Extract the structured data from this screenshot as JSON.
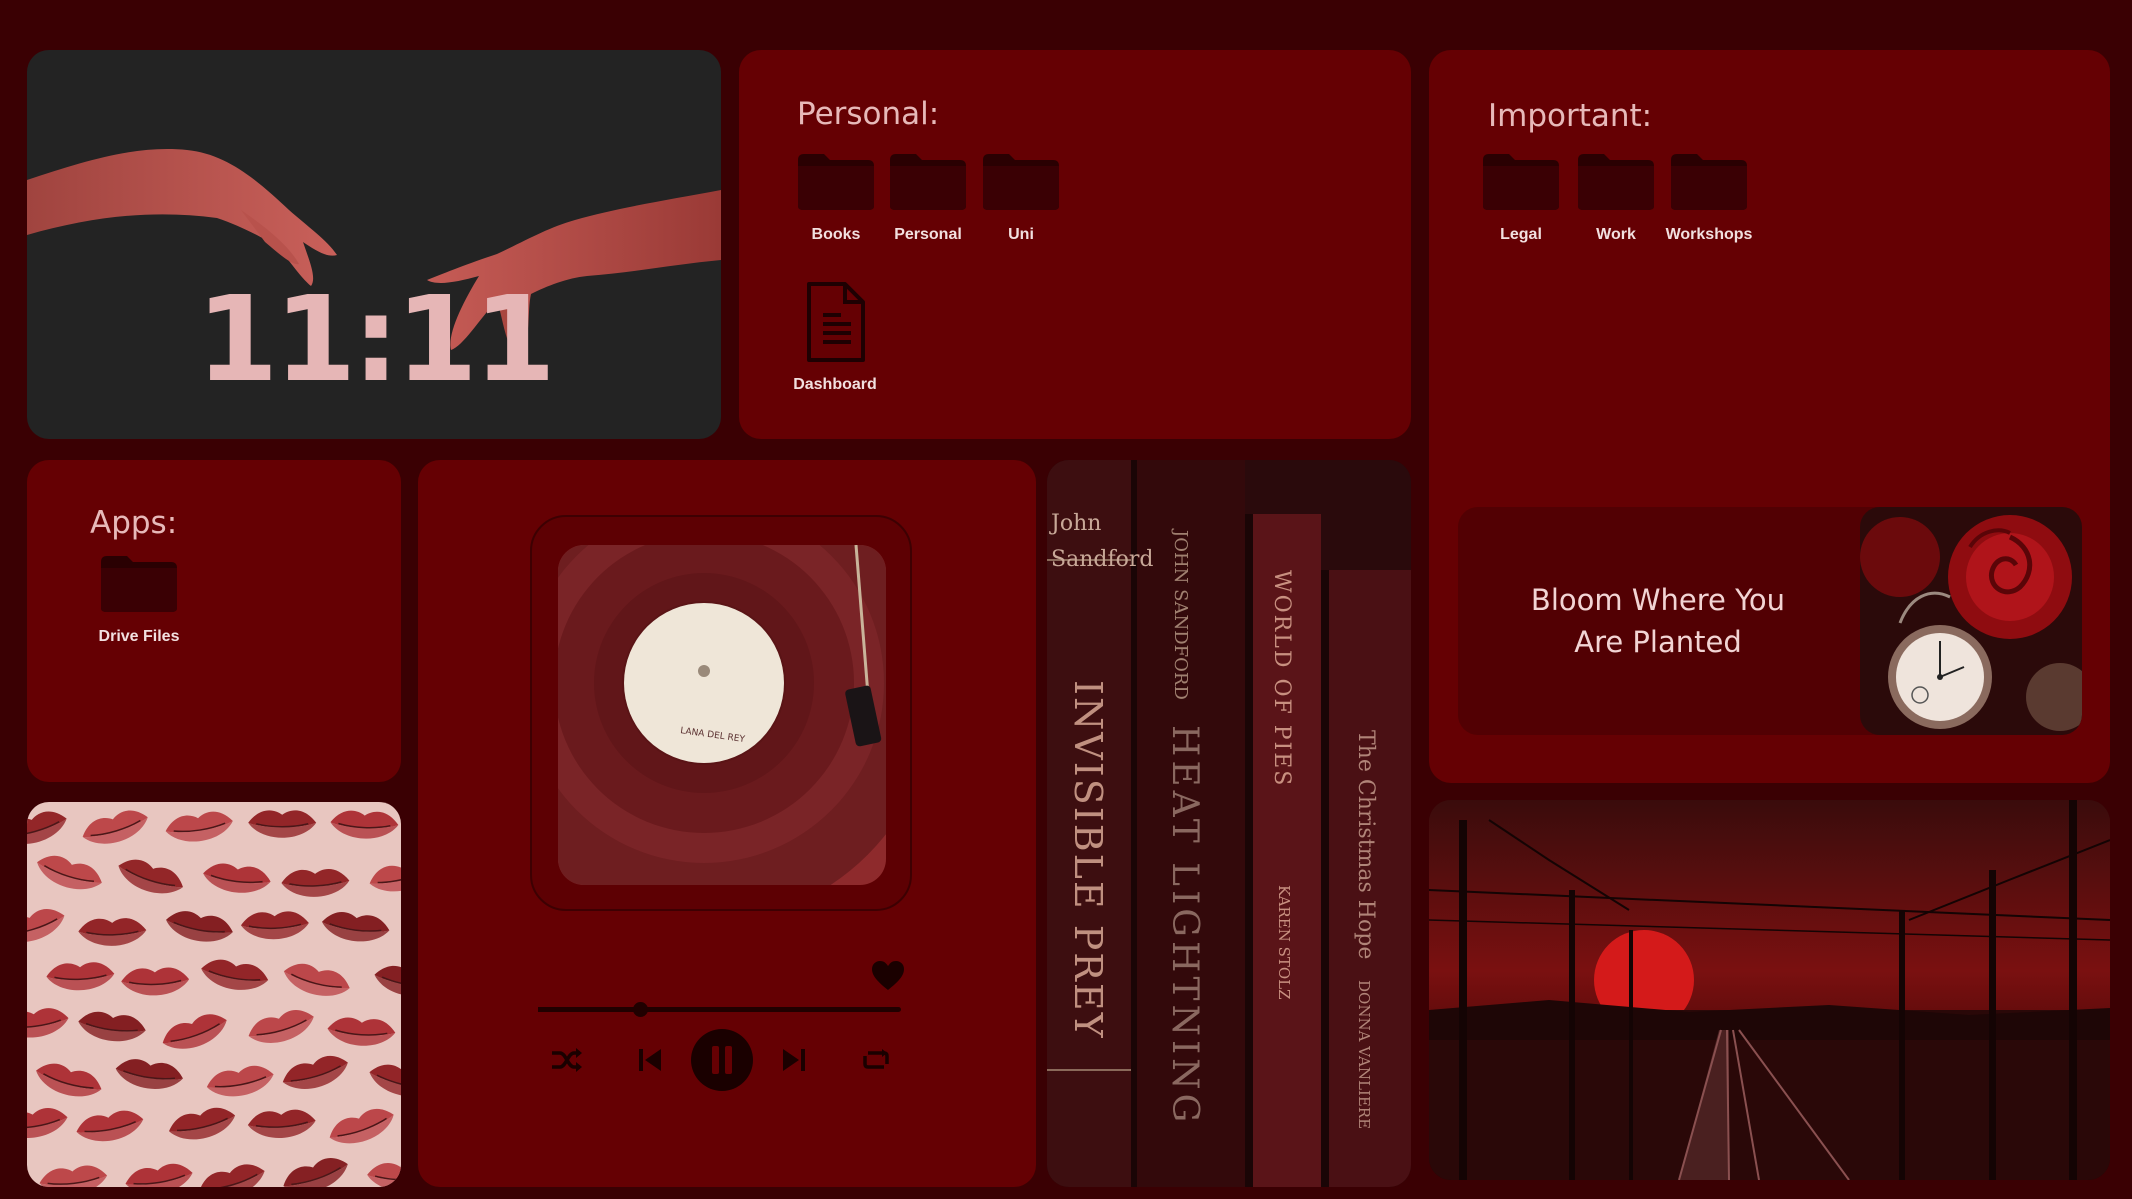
{
  "clock": {
    "time": "11:11"
  },
  "personal": {
    "title": "Personal:",
    "folders": [
      {
        "label": "Books",
        "icon": "folder-icon"
      },
      {
        "label": "Personal",
        "icon": "folder-icon"
      },
      {
        "label": "Uni",
        "icon": "folder-icon"
      }
    ],
    "documents": [
      {
        "label": "Dashboard",
        "icon": "document-icon"
      }
    ]
  },
  "important": {
    "title": "Important:",
    "folders": [
      {
        "label": "Legal",
        "icon": "folder-icon"
      },
      {
        "label": "Work",
        "icon": "folder-icon"
      },
      {
        "label": "Workshops",
        "icon": "folder-icon"
      }
    ]
  },
  "apps": {
    "title": "Apps:",
    "folders": [
      {
        "label": "Drive Files",
        "icon": "folder-icon"
      }
    ]
  },
  "quote": {
    "line1": "Bloom Where You",
    "line2": "Are Planted"
  },
  "player": {
    "progress": 0.28,
    "liked": true,
    "state": "playing",
    "controls": [
      "shuffle-icon",
      "previous-icon",
      "pause-icon",
      "next-icon",
      "repeat-icon"
    ],
    "record_label": "LANA DEL REY"
  },
  "books": {
    "spines": [
      {
        "title": "INVISIBLE PREY",
        "author": "John Sandford"
      },
      {
        "title": "HEAT LIGHTNING",
        "author": "JOHN SANDFORD"
      },
      {
        "title": "WORLD OF PIES",
        "author": "KAREN STOLZ"
      },
      {
        "title": "The Christmas Hope",
        "author": "DONNA VANLIERE"
      }
    ]
  },
  "colors": {
    "background": "#3a0003",
    "panel": "#650003",
    "card": "#520003",
    "title_text": "#e7b9b9",
    "clock_text": "#e6b6b6"
  }
}
